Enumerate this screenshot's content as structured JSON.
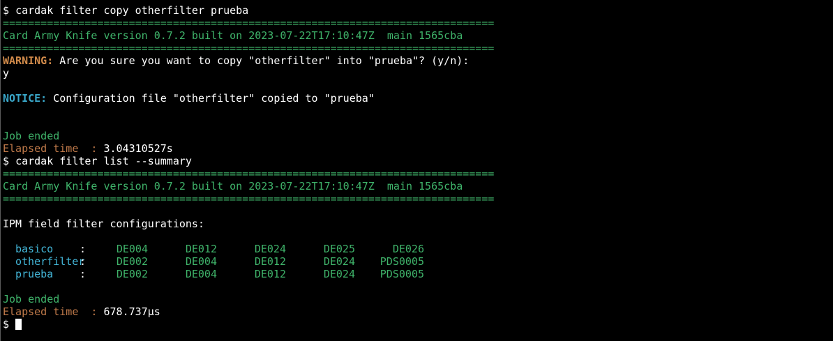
{
  "terminal": {
    "cmd1": {
      "prompt": "$",
      "command": "cardak filter copy otherfilter prueba"
    },
    "separator": "==============================================================================",
    "banner": "Card Army Knife version 0.7.2 built on 2023-07-22T17:10:47Z  main 1565cba",
    "warning_label": "WARNING:",
    "warning_text": " Are you sure you want to copy \"otherfilter\" into \"prueba\"? (y/n):",
    "answer": "y",
    "notice_label": "NOTICE:",
    "notice_text": " Configuration file \"otherfilter\" copied to \"prueba\"",
    "job_ended_1": "Job ended",
    "elapsed_label": "Elapsed time  :",
    "elapsed_value_1": " 3.04310527s",
    "cmd2": {
      "prompt": "$",
      "command": "cardak filter list --summary"
    },
    "section_title": "IPM field filter configurations:",
    "filters": [
      {
        "name": "basico",
        "colon": ":",
        "fields": [
          "DE004",
          "DE012",
          "DE024",
          "DE025",
          "DE026"
        ]
      },
      {
        "name": "otherfilter",
        "colon": ":",
        "fields": [
          "DE002",
          "DE004",
          "DE012",
          "DE024",
          "PDS0005"
        ]
      },
      {
        "name": "prueba",
        "colon": ":",
        "fields": [
          "DE002",
          "DE004",
          "DE012",
          "DE024",
          "PDS0005"
        ]
      }
    ],
    "job_ended_2": "Job ended",
    "elapsed_value_2": " 678.737µs",
    "final_prompt": "$"
  }
}
